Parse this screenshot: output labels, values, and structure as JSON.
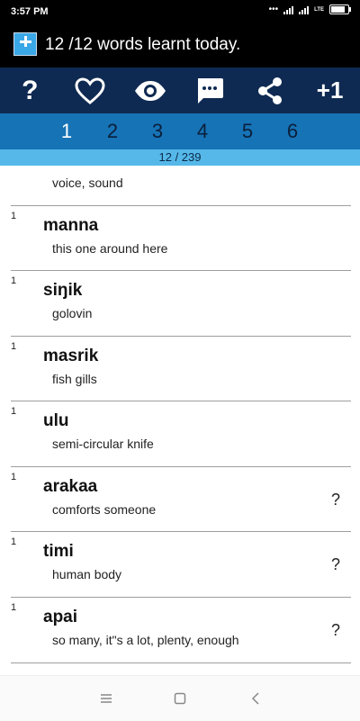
{
  "status": {
    "time": "3:57 PM",
    "network": "LTE",
    "battery_level": 0.9
  },
  "header": {
    "app_icon": "app-icon",
    "title": "12 /12 words learnt today."
  },
  "toolbar": {
    "items": [
      {
        "name": "help",
        "icon": "question-icon",
        "label": "?"
      },
      {
        "name": "favorite",
        "icon": "heart-icon"
      },
      {
        "name": "view",
        "icon": "eye-icon"
      },
      {
        "name": "comment",
        "icon": "chat-bubble-icon"
      },
      {
        "name": "share",
        "icon": "share-icon"
      },
      {
        "name": "plus-one",
        "icon": "plus-one",
        "label": "+1"
      }
    ]
  },
  "tabs": {
    "items": [
      "1",
      "2",
      "3",
      "4",
      "5",
      "6"
    ],
    "active": "1"
  },
  "progress": {
    "text": "12 / 239"
  },
  "list": {
    "partial_item": {
      "translation": "voice, sound"
    },
    "items": [
      {
        "count": "1",
        "word": "manna",
        "translation": "this one around here",
        "mark": ""
      },
      {
        "count": "1",
        "word": "siŋik",
        "translation": "golovin",
        "mark": ""
      },
      {
        "count": "1",
        "word": "masrik",
        "translation": "fish gills",
        "mark": ""
      },
      {
        "count": "1",
        "word": "ulu",
        "translation": "semi-circular knife",
        "mark": ""
      },
      {
        "count": "1",
        "word": "arakaa",
        "translation": "comforts someone",
        "mark": "?"
      },
      {
        "count": "1",
        "word": "timi",
        "translation": "human body",
        "mark": "?"
      },
      {
        "count": "1",
        "word": "apai",
        "translation": "so many, it\"s a lot, plenty, enough",
        "mark": "?"
      }
    ]
  },
  "navbar": {
    "items": [
      "menu-icon",
      "home-square-icon",
      "back-chevron-icon"
    ]
  },
  "colors": {
    "toolbar_bg": "#0f2a52",
    "tabs_bg": "#1673b6",
    "progress_bg": "#55b8e8"
  }
}
